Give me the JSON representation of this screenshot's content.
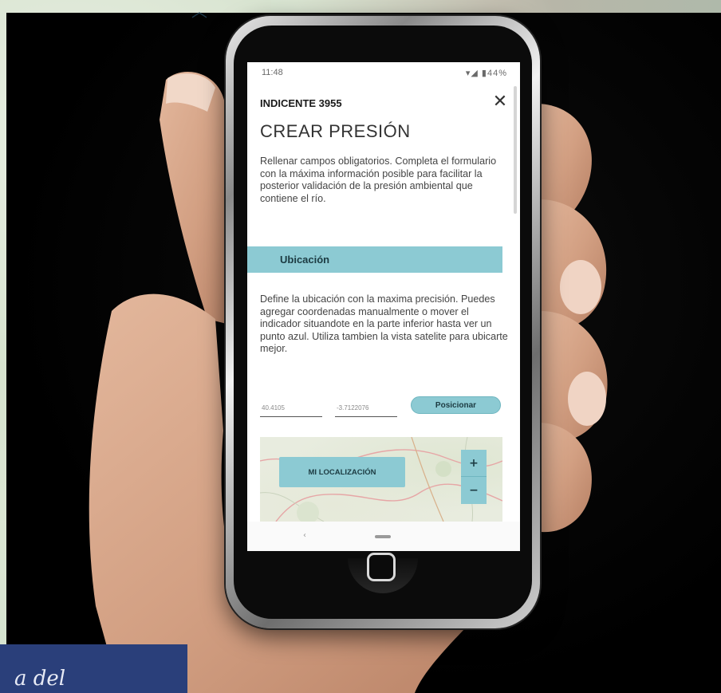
{
  "background": {
    "heading": "",
    "card_text": "a del"
  },
  "status_bar": {
    "time": "11:48",
    "icons": "▾◢ ▮44%"
  },
  "header": {
    "incident": "INDICENTE 3955",
    "title": "CREAR PRESIÓN",
    "close_icon": "close-icon"
  },
  "intro": {
    "text": "Rellenar campos obligatorios. Completa el formulario con la máxima información posible para facilitar la posterior validación de la presión ambiental que contiene el río."
  },
  "section": {
    "title": "Ubicación"
  },
  "location": {
    "text": "Define la ubicación con la maxima precisión. Puedes agregar coordenadas manualmente o mover el indicador situandote en la parte inferior hasta ver un punto azul. Utiliza tambien la vista satelite para ubicarte mejor.",
    "latitude_value": "40.4105",
    "longitude_value": "-3.7122076",
    "position_button": "Posicionar"
  },
  "map": {
    "locate_button": "MI LOCALIZACIÓN",
    "zoom_in": "+",
    "zoom_out": "−"
  },
  "nav": {
    "back": "‹"
  },
  "colors": {
    "accent": "#8ccad3",
    "accent_dark": "#1c3b42",
    "background_card": "#2a3f7a"
  }
}
